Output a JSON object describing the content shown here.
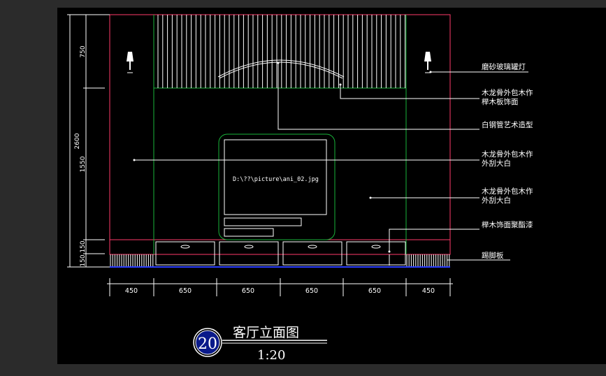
{
  "drawing": {
    "number": "20",
    "title": "客厅立面图",
    "scale": "1:20",
    "image_ref": "D:\\??\\picture\\ani_02.jpg"
  },
  "annotations": [
    "磨砂玻璃罐灯",
    "木龙骨外包木作\n榉木板饰面",
    "白钢管艺术造型",
    "木龙骨外包木作\n外刮大白",
    "木龙骨外包木作\n外刮大白",
    "榉木饰面聚酯漆",
    "踢脚板"
  ],
  "dims_horizontal": [
    "450",
    "650",
    "650",
    "650",
    "650",
    "450"
  ],
  "dims_vertical": [
    "750",
    "1550",
    "150",
    "150"
  ],
  "dim_total_height": "2600",
  "colors": {
    "background": "#000000",
    "outer": "#2b2b2b",
    "frame": "#ff3a6a",
    "panel": "#19b33a",
    "lines": "#ffffff",
    "base": "#2a3dff",
    "text": "#ffffff"
  }
}
